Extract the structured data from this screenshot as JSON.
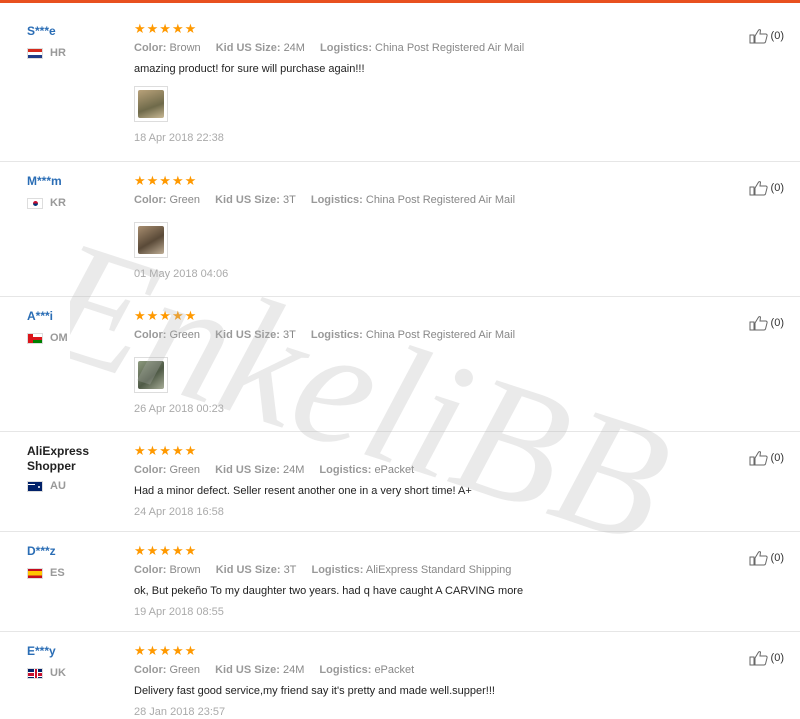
{
  "labels": {
    "color": "Color:",
    "size": "Kid US Size:",
    "logistics": "Logistics:"
  },
  "stars": "★★★★★",
  "watermark": "EnkeliBB",
  "reviews": [
    {
      "user": "S***e",
      "country": "HR",
      "color": "Brown",
      "size": "24M",
      "logistics": "China Post Registered Air Mail",
      "feedback": "amazing product! for sure will purchase again!!!",
      "has_photo": true,
      "date": "18 Apr 2018 22:38",
      "helpful": "(0)"
    },
    {
      "user": "M***m",
      "country": "KR",
      "color": "Green",
      "size": "3T",
      "logistics": "China Post Registered Air Mail",
      "feedback": "",
      "has_photo": true,
      "date": "01 May 2018 04:06",
      "helpful": "(0)"
    },
    {
      "user": "A***i",
      "country": "OM",
      "color": "Green",
      "size": "3T",
      "logistics": "China Post Registered Air Mail",
      "feedback": "",
      "has_photo": true,
      "date": "26 Apr 2018 00:23",
      "helpful": "(0)"
    },
    {
      "user": "AliExpress Shopper",
      "country": "AU",
      "color": "Green",
      "size": "24M",
      "logistics": "ePacket",
      "feedback": "Had a minor defect. Seller resent another one in a very short time! A+",
      "has_photo": false,
      "date": "24 Apr 2018 16:58",
      "helpful": "(0)"
    },
    {
      "user": "D***z",
      "country": "ES",
      "color": "Brown",
      "size": "3T",
      "logistics": "AliExpress Standard Shipping",
      "feedback": "ok, But pekeño To my daughter two years. had q have caught A CARVING more",
      "has_photo": false,
      "date": "19 Apr 2018 08:55",
      "helpful": "(0)"
    },
    {
      "user": "E***y",
      "country": "UK",
      "color": "Green",
      "size": "24M",
      "logistics": "ePacket",
      "feedback": "Delivery fast good service,my friend say it's pretty and made well.supper!!!",
      "has_photo": false,
      "date": "28 Jan 2018 23:57",
      "helpful": "(0)"
    }
  ],
  "colors": {
    "accent_bar": "#e8501f",
    "username": "#2a6db5",
    "stars": "#ff9900"
  }
}
